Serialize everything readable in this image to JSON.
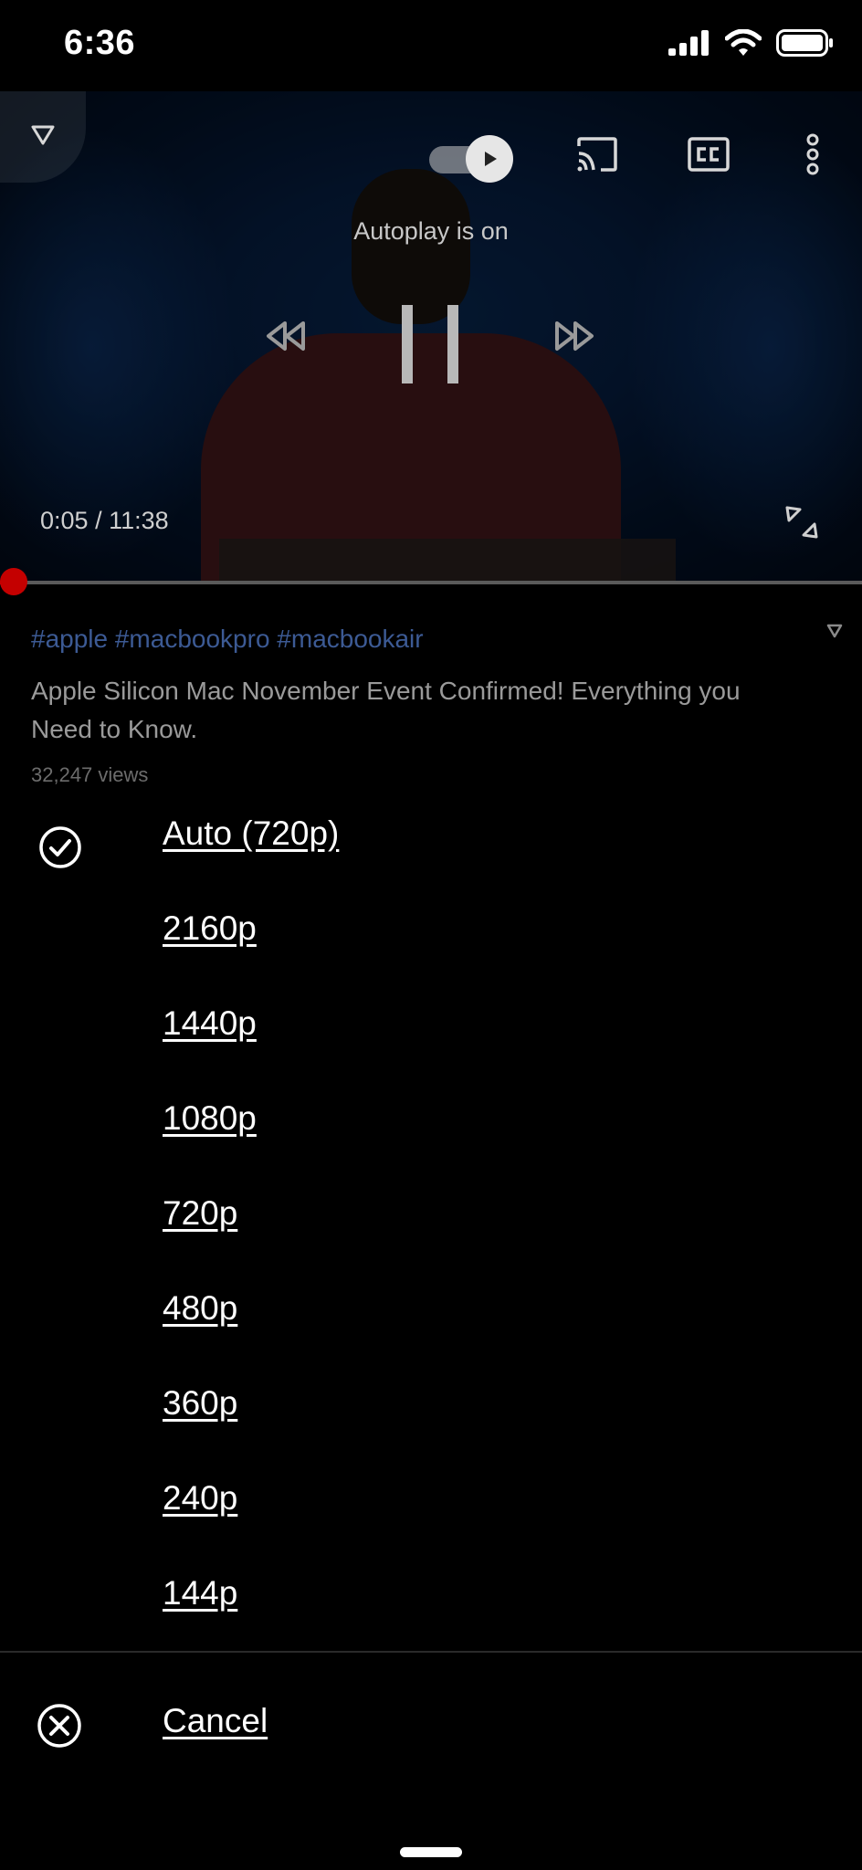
{
  "status_bar": {
    "time": "6:36",
    "icons": [
      "signal-icon",
      "wifi-icon",
      "battery-icon"
    ]
  },
  "player": {
    "autoplay_label": "Autoplay is on",
    "current_time": "0:05",
    "time_separator": " / ",
    "duration": "11:38",
    "progress_fraction": 0.007,
    "icons": [
      "chevron-down-icon",
      "autoplay-toggle-icon",
      "cast-icon",
      "cc-icon",
      "more-vert-icon",
      "rewind-icon",
      "pause-icon",
      "fast-forward-icon",
      "fullscreen-icon"
    ],
    "accent_color": "#c80000"
  },
  "video": {
    "hashtags": "#apple #macbookpro #macbookair",
    "title": "Apple Silicon Mac November Event Confirmed! Everything you Need to Know.",
    "views": "32,247 views"
  },
  "quality_menu": {
    "selected_index": 0,
    "options": [
      {
        "label": "Auto (720p)"
      },
      {
        "label": "2160p"
      },
      {
        "label": "1440p"
      },
      {
        "label": "1080p"
      },
      {
        "label": "720p"
      },
      {
        "label": "480p"
      },
      {
        "label": "360p"
      },
      {
        "label": "240p"
      },
      {
        "label": "144p"
      }
    ],
    "cancel_label": "Cancel"
  }
}
